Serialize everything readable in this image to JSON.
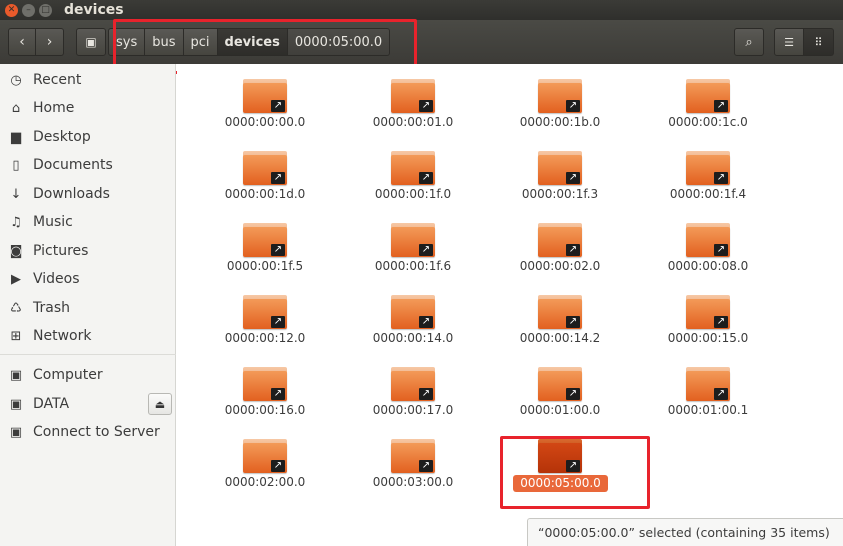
{
  "window": {
    "title": "devices",
    "close_glyph": "✕",
    "min_glyph": "–",
    "max_glyph": "□"
  },
  "toolbar": {
    "back_icon": "‹",
    "forward_icon": "›",
    "root_icon": "▣",
    "breadcrumbs": [
      "sys",
      "bus",
      "pci",
      "devices",
      "0000:05:00.0"
    ],
    "search_icon": "⌕",
    "list_icon": "☰",
    "grid_icon": "⠿"
  },
  "sidebar": {
    "places": [
      {
        "label": "Recent",
        "icon": "clock-icon",
        "glyph": "◷"
      },
      {
        "label": "Home",
        "icon": "home-icon",
        "glyph": "⌂"
      },
      {
        "label": "Desktop",
        "icon": "desktop-folder-icon",
        "glyph": "▆"
      },
      {
        "label": "Documents",
        "icon": "document-icon",
        "glyph": "▯"
      },
      {
        "label": "Downloads",
        "icon": "download-icon",
        "glyph": "↓"
      },
      {
        "label": "Music",
        "icon": "music-icon",
        "glyph": "♫"
      },
      {
        "label": "Pictures",
        "icon": "camera-icon",
        "glyph": "◙"
      },
      {
        "label": "Videos",
        "icon": "video-icon",
        "glyph": "▶"
      },
      {
        "label": "Trash",
        "icon": "trash-icon",
        "glyph": "♺"
      },
      {
        "label": "Network",
        "icon": "network-icon",
        "glyph": "⊞"
      }
    ],
    "devices": [
      {
        "label": "Computer",
        "icon": "computer-icon",
        "glyph": "▣"
      },
      {
        "label": "DATA",
        "icon": "drive-icon",
        "glyph": "▣"
      },
      {
        "label": "Connect to Server",
        "icon": "server-icon",
        "glyph": "▣"
      }
    ],
    "eject_glyph": "⏏"
  },
  "files": [
    "0000:00:00.0",
    "0000:00:01.0",
    "0000:00:1b.0",
    "0000:00:1c.0",
    "0000:00:1d.0",
    "0000:00:1f.0",
    "0000:00:1f.3",
    "0000:00:1f.4",
    "0000:00:1f.5",
    "0000:00:1f.6",
    "0000:00:02.0",
    "0000:00:08.0",
    "0000:00:12.0",
    "0000:00:14.0",
    "0000:00:14.2",
    "0000:00:15.0",
    "0000:00:16.0",
    "0000:00:17.0",
    "0000:01:00.0",
    "0000:01:00.1",
    "0000:02:00.0",
    "0000:03:00.0",
    "0000:05:00.0"
  ],
  "selected_file": "0000:05:00.0",
  "status": {
    "text": "“0000:05:00.0” selected  (containing 35 items)"
  },
  "colors": {
    "accent": "#e9683a",
    "highlight_box": "#e8232c",
    "folder": "#ea7a3a"
  }
}
